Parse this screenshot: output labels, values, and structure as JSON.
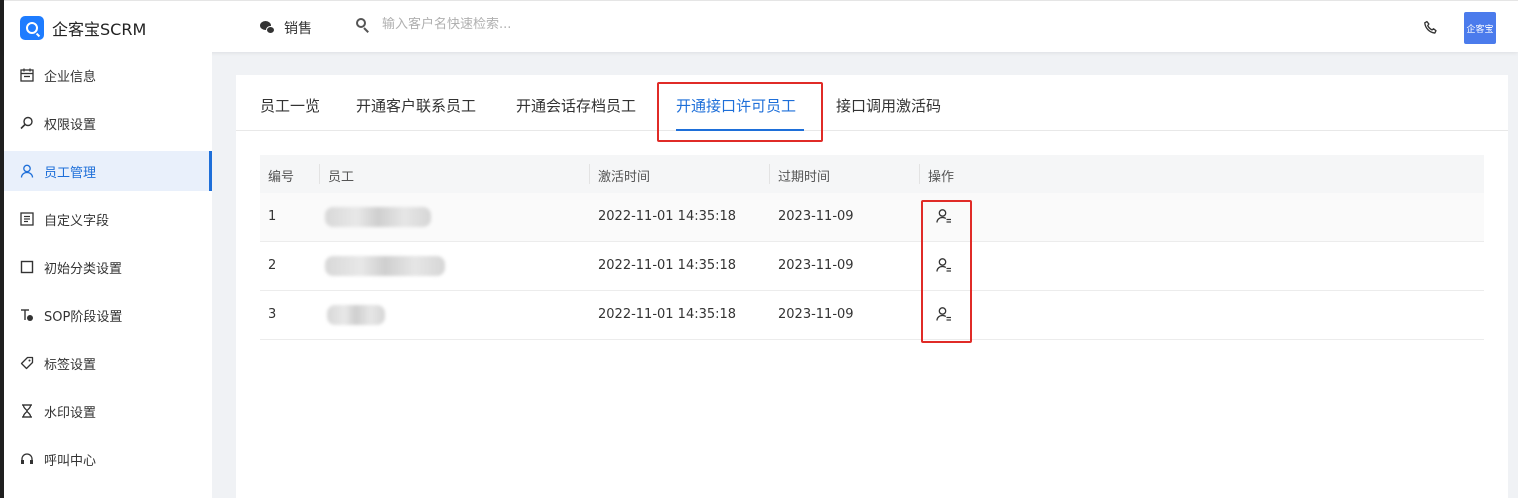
{
  "app": {
    "name": "企客宝SCRM"
  },
  "header": {
    "channel_label": "销售",
    "search_placeholder": "输入客户名快速检索...",
    "avatar_text": "企客宝"
  },
  "sidebar": {
    "items": [
      {
        "label": "企业信息",
        "icon": "calendar-icon"
      },
      {
        "label": "权限设置",
        "icon": "search-key-icon"
      },
      {
        "label": "员工管理",
        "icon": "user-icon",
        "active": true
      },
      {
        "label": "自定义字段",
        "icon": "form-icon"
      },
      {
        "label": "初始分类设置",
        "icon": "square-icon"
      },
      {
        "label": "SOP阶段设置",
        "icon": "sop-icon"
      },
      {
        "label": "标签设置",
        "icon": "tag-icon"
      },
      {
        "label": "水印设置",
        "icon": "hourglass-icon"
      },
      {
        "label": "呼叫中心",
        "icon": "headset-icon"
      }
    ]
  },
  "tabs": [
    {
      "label": "员工一览"
    },
    {
      "label": "开通客户联系员工"
    },
    {
      "label": "开通会话存档员工"
    },
    {
      "label": "开通接口许可员工",
      "active": true
    },
    {
      "label": "接口调用激活码"
    }
  ],
  "table": {
    "columns": [
      "编号",
      "员工",
      "激活时间",
      "过期时间",
      "操作"
    ],
    "rows": [
      {
        "id": "1",
        "employee": "",
        "activated": "2022-11-01 14:35:18",
        "expires": "2023-11-09"
      },
      {
        "id": "2",
        "employee": "",
        "activated": "2022-11-01 14:35:18",
        "expires": "2023-11-09"
      },
      {
        "id": "3",
        "employee": "",
        "activated": "2022-11-01 14:35:18",
        "expires": "2023-11-09"
      }
    ]
  },
  "colors": {
    "accent": "#1e6fd9",
    "highlight": "#e02b27",
    "logo": "#1e7cff"
  }
}
